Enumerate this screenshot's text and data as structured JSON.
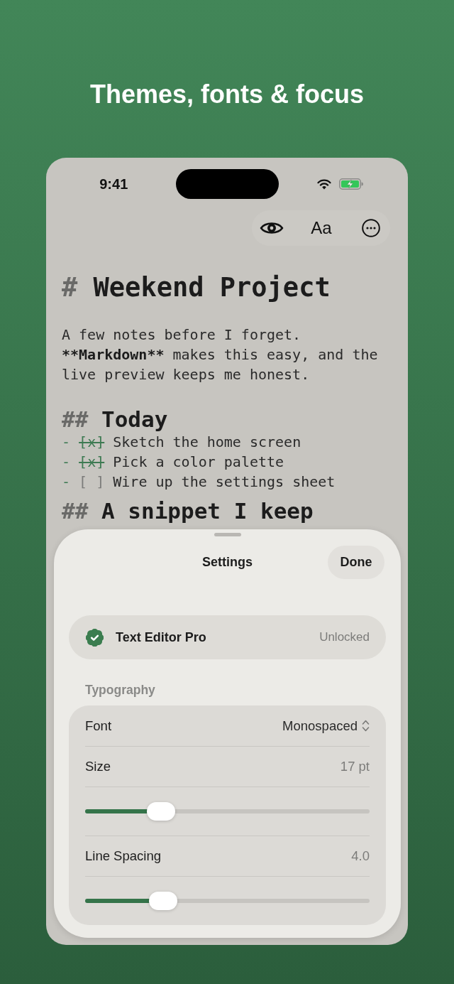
{
  "headline": "Themes, fonts & focus",
  "status_bar": {
    "time": "9:41"
  },
  "toolbar": {
    "font_button": "Aa"
  },
  "document": [
    {
      "kind": "h1",
      "marker": "#",
      "text": "Weekend Project"
    },
    {
      "kind": "paragraph",
      "parts": [
        {
          "text": "A few notes before I forget. ",
          "strong": false
        },
        {
          "text": "**Markdown**",
          "strong": true
        },
        {
          "text": " makes this easy, and the live preview keeps me honest.",
          "strong": false
        }
      ]
    },
    {
      "kind": "h2",
      "marker": "##",
      "text": "Today"
    },
    {
      "kind": "task",
      "bullet": "-",
      "box": "[x]",
      "checked": true,
      "text": "Sketch the home screen"
    },
    {
      "kind": "task",
      "bullet": "-",
      "box": "[x]",
      "checked": true,
      "text": "Pick a color palette"
    },
    {
      "kind": "task",
      "bullet": "-",
      "box": "[ ]",
      "checked": false,
      "text": "Wire up the settings sheet"
    },
    {
      "kind": "h2",
      "marker": "##",
      "text": "A snippet I keep"
    }
  ],
  "sheet": {
    "title": "Settings",
    "done": "Done",
    "pro": {
      "name": "Text Editor Pro",
      "status": "Unlocked"
    },
    "sections": [
      {
        "title": "Typography",
        "rows": [
          {
            "kind": "picker",
            "label": "Font",
            "value": "Monospaced"
          },
          {
            "kind": "value",
            "label": "Size",
            "value": "17 pt"
          },
          {
            "kind": "slider",
            "level": 0.24
          },
          {
            "kind": "value",
            "label": "Line Spacing",
            "value": "4.0"
          },
          {
            "kind": "slider",
            "level": 0.25
          }
        ]
      }
    ]
  }
}
